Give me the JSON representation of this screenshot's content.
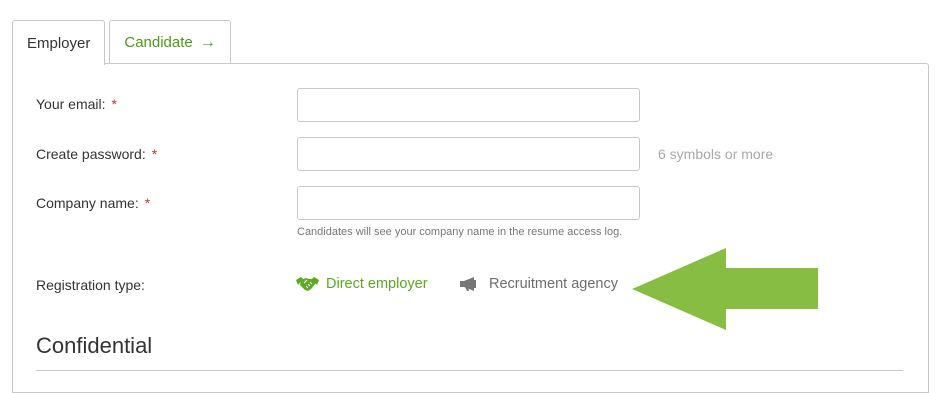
{
  "tabs": [
    {
      "label": "Employer",
      "active": true
    },
    {
      "label": "Candidate",
      "active": false,
      "icon": "arrow-right-icon"
    }
  ],
  "form": {
    "email": {
      "label": "Your email:",
      "required_mark": "*",
      "value": "",
      "placeholder": ""
    },
    "password": {
      "label": "Create password:",
      "required_mark": "*",
      "value": "",
      "placeholder": "",
      "hint": "6 symbols or more"
    },
    "company": {
      "label": "Company name:",
      "required_mark": "*",
      "value": "",
      "placeholder": "",
      "note": "Candidates will see your company name in the resume access log."
    },
    "registration_type": {
      "label": "Registration type:",
      "options": [
        {
          "label": "Direct employer",
          "icon": "handshake-icon",
          "selected": true,
          "color": "#5aa91e"
        },
        {
          "label": "Recruitment agency",
          "icon": "megaphone-icon",
          "selected": false,
          "color": "#6d6d6d"
        }
      ]
    }
  },
  "section": {
    "title": "Confidential"
  },
  "annotation": {
    "icon": "big-arrow-left-icon",
    "color": "#86bd42"
  },
  "colors": {
    "accent_green": "#4a9a14",
    "required_red": "#c0392b",
    "border": "#c8c8c8",
    "hint_gray": "#a8a8a8"
  }
}
